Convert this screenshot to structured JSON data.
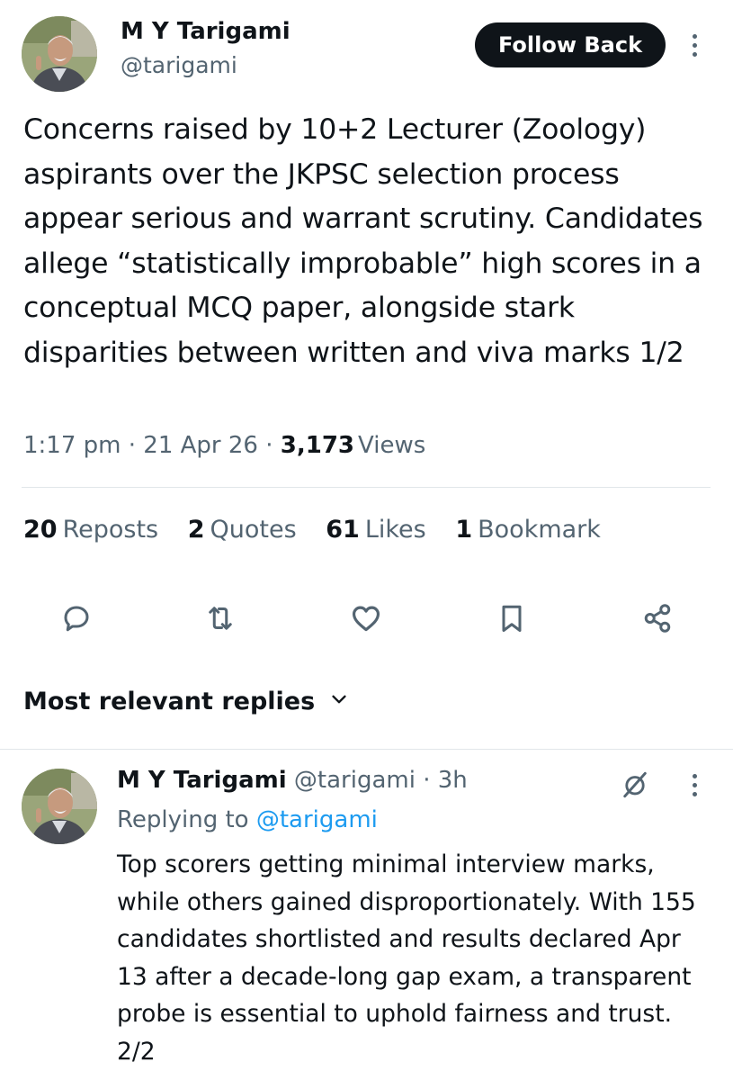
{
  "tweet": {
    "author_name": "M Y Tarigami",
    "author_handle": "@tarigami",
    "follow_label": "Follow Back",
    "text": "Concerns raised by 10+2 Lecturer (Zoology) aspirants over the JKPSC selection process appear serious and warrant scrutiny. Candidates allege “statistically improbable” high scores in a conceptual MCQ paper, alongside stark disparities between written and viva marks 1/2",
    "time": "1:17 pm",
    "date": "21 Apr 26",
    "views_count": "3,173",
    "views_label": "Views",
    "separator": "·"
  },
  "stats": [
    {
      "count": "20",
      "label": "Reposts"
    },
    {
      "count": "2",
      "label": "Quotes"
    },
    {
      "count": "61",
      "label": "Likes"
    },
    {
      "count": "1",
      "label": "Bookmark"
    }
  ],
  "actions": [
    "reply-icon",
    "repost-icon",
    "like-icon",
    "bookmark-icon",
    "share-icon"
  ],
  "replies_header": {
    "label": "Most relevant replies",
    "icon": "chevron-down-icon"
  },
  "reply": {
    "author_name": "M Y Tarigami",
    "author_handle": "@tarigami",
    "separator": "·",
    "time_ago": "3h",
    "replying_prefix": "Replying to",
    "replying_handle": "@tarigami",
    "text": "Top scorers getting minimal interview marks, while others gained disproportionately. With 155 candidates shortlisted and results declared Apr 13 after a decade-long gap exam, a transparent probe is essential to uphold fairness and trust. 2/2",
    "grok_icon": "grok-icon"
  },
  "colors": {
    "text": "#0f1419",
    "secondary": "#536471",
    "link": "#1d9bf0",
    "button_bg": "#0f1419",
    "divider": "#e1e6ea"
  }
}
